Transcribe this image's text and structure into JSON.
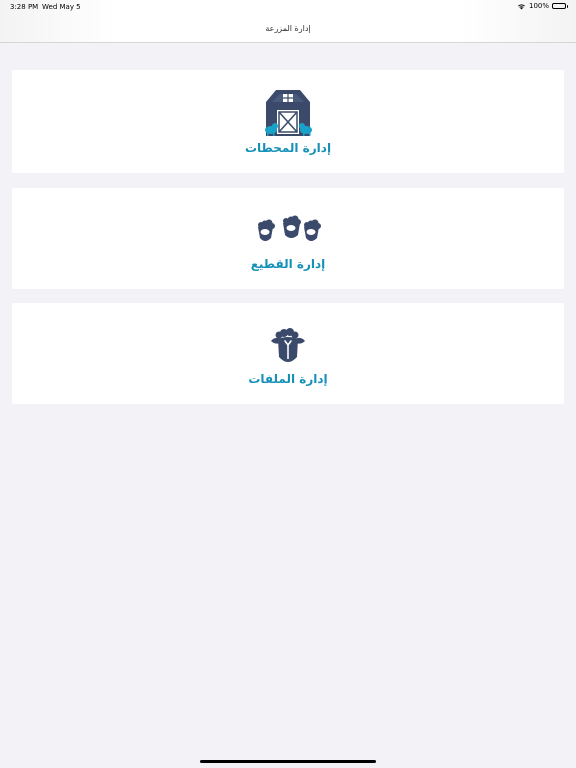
{
  "status_bar": {
    "time": "3:28 PM",
    "date": "Wed May 5",
    "battery_text": "100%"
  },
  "nav": {
    "title": "إدارة المزرعة"
  },
  "cards": [
    {
      "label": "إدارة المحطات",
      "icon": "barn-icon"
    },
    {
      "label": "إدارة القطيع",
      "icon": "sheep-flock-icon"
    },
    {
      "label": "إدارة الملفات",
      "icon": "sheep-file-icon"
    }
  ],
  "colors": {
    "accent": "#1591b8",
    "icon_dark": "#3b4a6b",
    "background": "#f2f2f7"
  }
}
